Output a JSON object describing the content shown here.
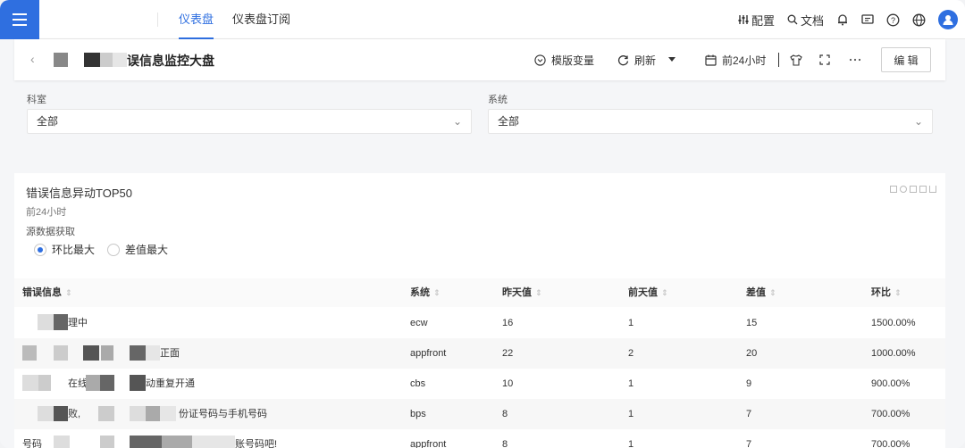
{
  "nav": {
    "tabs": [
      {
        "label": "仪表盘",
        "active": true
      },
      {
        "label": "仪表盘订阅",
        "active": false
      }
    ],
    "right": {
      "config": "配置",
      "docs": "文档"
    },
    "accent": "#2f6fe0"
  },
  "header": {
    "title": "误信息监控大盘",
    "template_vars": "模版变量",
    "refresh": "刷新",
    "time_range": "前24小时",
    "edit": "编 辑"
  },
  "filters": [
    {
      "label": "科室",
      "value": "全部"
    },
    {
      "label": "系统",
      "value": "全部"
    }
  ],
  "panel": {
    "title": "错误信息异动TOP50",
    "subtitle": "前24小时",
    "source_label": "源数据获取",
    "options": [
      {
        "label": "环比最大",
        "selected": true
      },
      {
        "label": "差值最大",
        "selected": false
      }
    ],
    "columns": [
      "错误信息",
      "系统",
      "昨天值",
      "前天值",
      "差值",
      "环比"
    ],
    "rows": [
      {
        "msg": "理中",
        "system": "ecw",
        "yesterday": "16",
        "daybefore": "1",
        "diff": "15",
        "ratio": "1500.00%"
      },
      {
        "msg": "正面",
        "system": "appfront",
        "yesterday": "22",
        "daybefore": "2",
        "diff": "20",
        "ratio": "1000.00%"
      },
      {
        "msg_a": "在线",
        "msg": "动重复开通",
        "system": "cbs",
        "yesterday": "10",
        "daybefore": "1",
        "diff": "9",
        "ratio": "900.00%"
      },
      {
        "msg_a": "败,",
        "msg": "份证号码与手机号码",
        "system": "bps",
        "yesterday": "8",
        "daybefore": "1",
        "diff": "7",
        "ratio": "700.00%"
      },
      {
        "msg_a": "号码",
        "msg": "账号码吧!",
        "system": "appfront",
        "yesterday": "8",
        "daybefore": "1",
        "diff": "7",
        "ratio": "700.00%"
      }
    ]
  }
}
